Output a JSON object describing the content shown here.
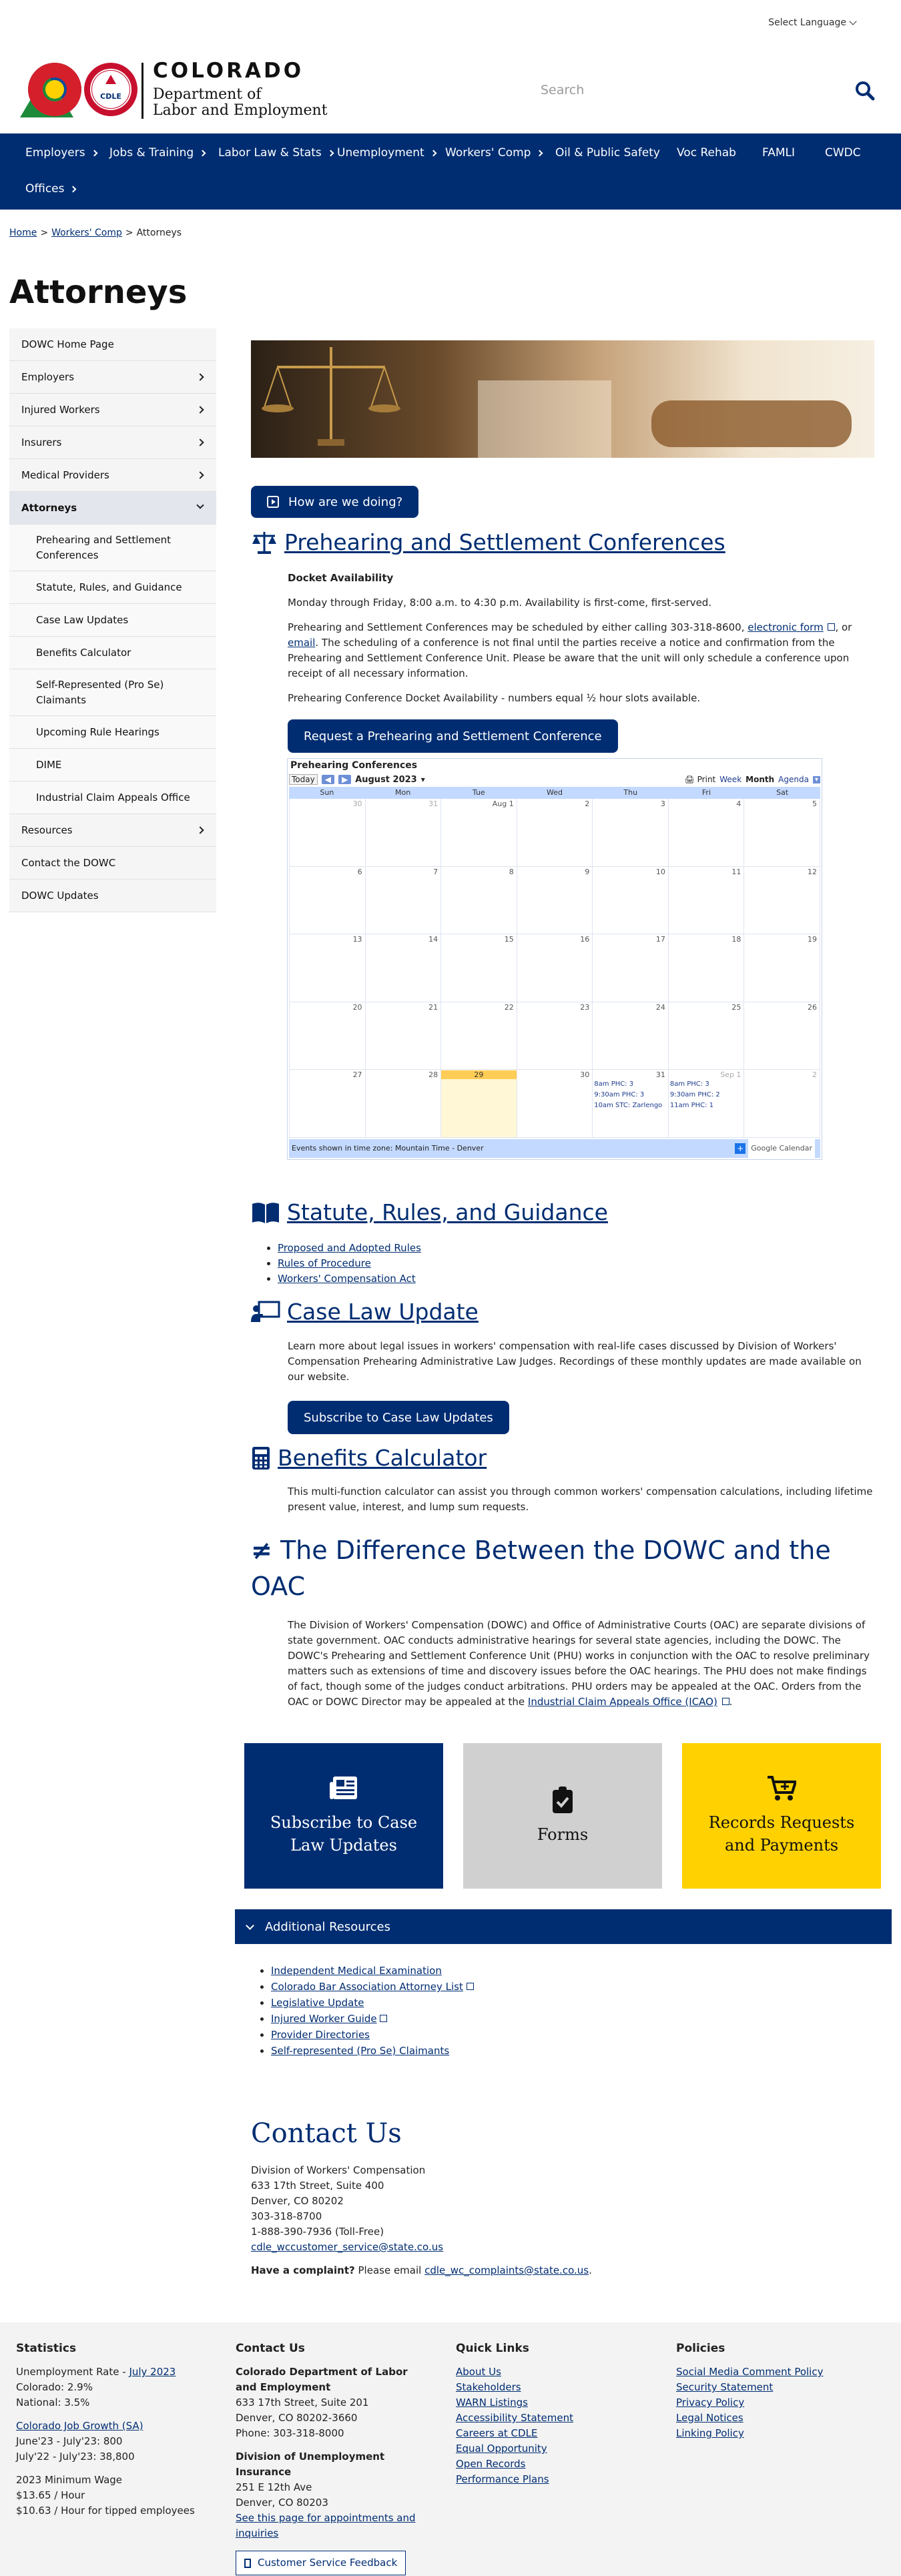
{
  "language": {
    "label": "Select Language"
  },
  "header": {
    "state": "COLORADO",
    "dept_line1": "Department of",
    "dept_line2": "Labor and Employment",
    "seal_text": "CDLE",
    "search_placeholder": "Search"
  },
  "nav": {
    "items": [
      {
        "label": "Employers",
        "has_sub": true
      },
      {
        "label": "Jobs & Training",
        "has_sub": true
      },
      {
        "label": "Labor Law & Stats",
        "has_sub": true
      },
      {
        "label": "Unemployment",
        "has_sub": true
      },
      {
        "label": "Workers' Comp",
        "has_sub": true
      },
      {
        "label": "Oil & Public Safety",
        "has_sub": false
      },
      {
        "label": "Voc Rehab",
        "has_sub": false
      },
      {
        "label": "FAMLI",
        "has_sub": false
      },
      {
        "label": "CWDC",
        "has_sub": false
      },
      {
        "label": "Offices",
        "has_sub": true
      }
    ]
  },
  "breadcrumb": {
    "home": "Home",
    "sep": ">",
    "workers_comp": "Workers' Comp",
    "current": "Attorneys"
  },
  "page_title": "Attorneys",
  "sidebar": {
    "items": [
      {
        "label": "DOWC Home Page"
      },
      {
        "label": "Employers"
      },
      {
        "label": "Injured Workers"
      },
      {
        "label": "Insurers"
      },
      {
        "label": "Medical Providers"
      },
      {
        "label": "Attorneys"
      },
      {
        "label": "Prehearing and Settlement Conferences"
      },
      {
        "label": "Statute, Rules, and Guidance"
      },
      {
        "label": "Case Law Updates"
      },
      {
        "label": "Benefits Calculator"
      },
      {
        "label": "Self-Represented (Pro Se) Claimants"
      },
      {
        "label": "Upcoming Rule Hearings"
      },
      {
        "label": "DIME"
      },
      {
        "label": "Industrial Claim Appeals Office"
      },
      {
        "label": "Resources"
      },
      {
        "label": "Contact the DOWC"
      },
      {
        "label": "DOWC Updates"
      }
    ]
  },
  "feedback_button": "How are we doing?",
  "prehearing": {
    "heading": "Prehearing and Settlement Conferences",
    "docket_title": "Docket Availability",
    "hours": "Monday through Friday, 8:00 a.m. to 4:30 p.m. Availability is first-come, first-served.",
    "para_a": "Prehearing and Settlement Conferences may be scheduled by either calling 303-318-8600,",
    "link_form": "electronic form",
    "para_b": ", or",
    "link_email": "email",
    "para_c": ". The scheduling of a conference is not final until the parties receive a notice and confirmation from the Prehearing and Settlement Conference Unit. Please be aware that the unit will only schedule a conference upon receipt of all necessary information.",
    "docket_note": "Prehearing Conference Docket Availability - numbers equal ½ hour slots available.",
    "request_button": "Request a Prehearing and Settlement Conference"
  },
  "calendar": {
    "title": "Prehearing Conferences",
    "today": "Today",
    "month": "August 2023",
    "print": "Print",
    "views": [
      "Week",
      "Month",
      "Agenda"
    ],
    "days": [
      "Sun",
      "Mon",
      "Tue",
      "Wed",
      "Thu",
      "Fri",
      "Sat"
    ],
    "dates": [
      "30",
      "31",
      "Aug 1",
      "2",
      "3",
      "4",
      "5",
      "6",
      "7",
      "8",
      "9",
      "10",
      "11",
      "12",
      "13",
      "14",
      "15",
      "16",
      "17",
      "18",
      "19",
      "20",
      "21",
      "22",
      "23",
      "24",
      "25",
      "26",
      "27",
      "28",
      "29",
      "30",
      "31",
      "Sep 1",
      "2"
    ],
    "events_thu": [
      "8am PHC: 3",
      "9:30am PHC: 3",
      "10am STC: Zarlengo"
    ],
    "events_fri": [
      "8am PHC: 3",
      "9:30am PHC: 2",
      "11am PHC: 1"
    ],
    "timezone": "Events shown in time zone: Mountain Time - Denver",
    "gcal": "Google Calendar"
  },
  "statute": {
    "heading": "Statute, Rules, and Guidance",
    "links": [
      "Proposed and Adopted Rules",
      "Rules of Procedure",
      "Workers' Compensation Act"
    ]
  },
  "caselaw": {
    "heading": "Case Law Update",
    "body": "Learn more about legal issues in workers' compensation with real-life cases discussed by Division of Workers' Compensation Prehearing Administrative Law Judges. Recordings of these monthly updates are made available on our website.",
    "button": "Subscribe to Case Law Updates"
  },
  "benefits": {
    "heading": "Benefits Calculator",
    "body": "This multi-function calculator can assist you through common workers' compensation calculations, including lifetime present value, interest, and lump sum requests."
  },
  "difference": {
    "heading_line1": "The Difference Between the DOWC and the",
    "heading_line2": "OAC",
    "body": "The Division of Workers' Compensation (DOWC) and Office of Administrative Courts (OAC) are separate divisions of state government. OAC conducts administrative hearings for several state agencies, including the DOWC. The DOWC's Prehearing and Settlement Conference Unit (PHU) works in conjunction with the OAC to resolve preliminary matters such as extensions of time and discovery issues before the OAC hearings. The PHU does not make findings of fact, though some of the judges conduct arbitrations. PHU orders may be appealed at the OAC. Orders from the OAC or DOWC Director may be appealed at the",
    "link": "Industrial Claim Appeals Office (ICAO)",
    "end": "."
  },
  "tiles": [
    {
      "label": "Subscribe to Case Law Updates",
      "color": "#002d72"
    },
    {
      "label": "Forms",
      "color": "#d0d0d0"
    },
    {
      "label": "Records Requests and Payments",
      "color": "#ffd100"
    }
  ],
  "additional": {
    "title": "Additional Resources",
    "links": [
      "Independent Medical Examination",
      "Colorado Bar Association Attorney List",
      "Legislative Update",
      "Injured Worker Guide",
      "Provider Directories",
      "Self-represented (Pro Se) Claimants"
    ]
  },
  "contact": {
    "heading": "Contact Us",
    "lines": [
      "Division of Workers' Compensation",
      "633 17th Street, Suite 400",
      "Denver, CO 80202",
      "303-318-8700",
      "1-888-390-7936 (Toll-Free)"
    ],
    "email": "cdle_wccustomer_service@state.co.us",
    "complaint_label": "Have a complaint?",
    "complaint_text": "Please email",
    "complaint_email": "cdle_wc_complaints@state.co.us",
    "complaint_end": "."
  },
  "footer": {
    "stats": {
      "title": "Statistics",
      "unemp_label": "Unemployment Rate -",
      "unemp_link": "July 2023",
      "colorado": "Colorado: 2.9%",
      "national": "National: 3.5%",
      "job_growth_link": "Colorado Job Growth (SA)",
      "growth1": "June'23 - July'23: 800",
      "growth2": "July'22 - July'23: 38,800",
      "wage_title": "2023 Minimum Wage",
      "wage1": "$13.65 / Hour",
      "wage2": "$10.63 / Hour for tipped employees"
    },
    "contact": {
      "title": "Contact Us",
      "org": "Colorado Department of Labor and Employment",
      "addr1": "633 17th Street, Suite 201",
      "addr2": "Denver, CO  80202-3660",
      "phone": "Phone:  303-318-8000",
      "div": "Division of Unemployment Insurance",
      "daddr1": "251 E 12th Ave",
      "daddr2": "Denver, CO  80203",
      "appt_link": "See this page for appointments and inquiries",
      "feedback": "Customer Service Feedback"
    },
    "quick": {
      "title": "Quick Links",
      "links": [
        "About Us",
        "Stakeholders",
        "WARN Listings",
        "Accessibility Statement",
        "Careers at CDLE",
        "Equal Opportunity",
        "Open Records",
        "Performance Plans"
      ]
    },
    "policies": {
      "title": "Policies",
      "links": [
        "Social Media Comment Policy",
        "Security Statement",
        "Privacy Policy",
        "Legal Notices",
        "Linking Policy"
      ]
    }
  },
  "colors": {
    "navy": "#002d72",
    "gold": "#ffd100",
    "gray_tile": "#d0d0d0"
  }
}
